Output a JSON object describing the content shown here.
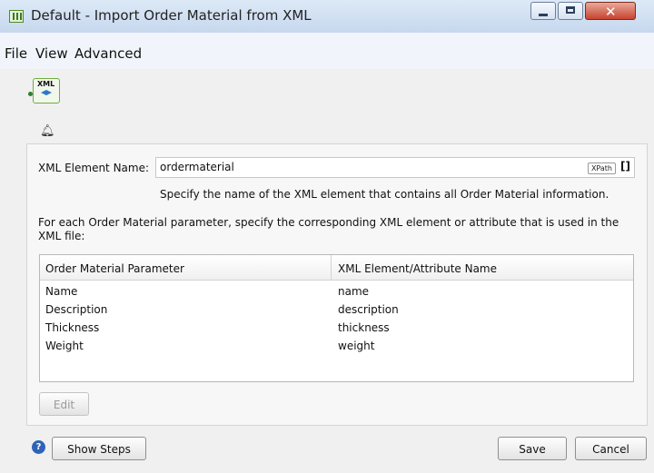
{
  "window": {
    "title": "Default - Import Order Material from XML"
  },
  "menu": [
    "File",
    "View",
    "Advanced"
  ],
  "xml_icon": {
    "label": "XML"
  },
  "form": {
    "element_label": "XML Element Name:",
    "element_value": "ordermaterial",
    "xpath_badge": "XPath",
    "brackets": "[]",
    "hint": "Specify the name of the XML element that contains all Order Material information.",
    "description": "For each Order Material parameter, specify the corresponding XML element or attribute that is used in the XML file:"
  },
  "table": {
    "headers": [
      "Order Material Parameter",
      "XML Element/Attribute Name"
    ],
    "rows": [
      [
        "Name",
        "name"
      ],
      [
        "Description",
        "description"
      ],
      [
        "Thickness",
        "thickness"
      ],
      [
        "Weight",
        "weight"
      ]
    ]
  },
  "buttons": {
    "edit": "Edit",
    "help": "?",
    "show_steps": "Show Steps",
    "save": "Save",
    "cancel": "Cancel"
  }
}
